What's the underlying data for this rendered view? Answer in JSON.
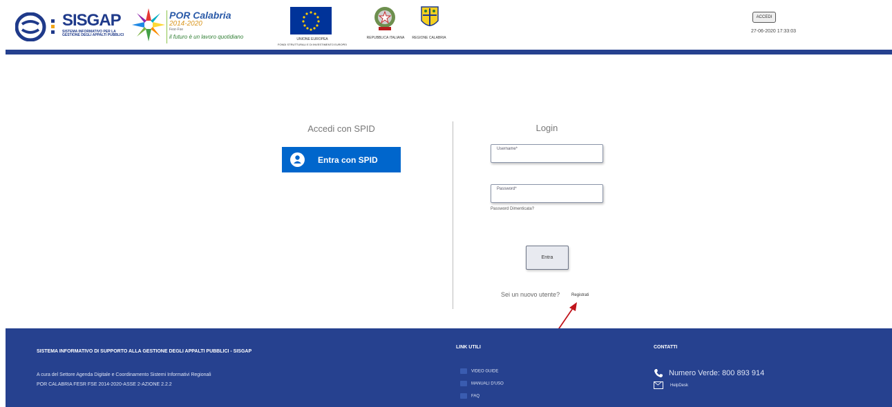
{
  "header": {
    "sisgap_brand": "SISGAP",
    "sisgap_sub": "SISTEMA INFORMATIVO PER LA GESTIONE DEGLI APPALTI PUBBLICI",
    "por_title": "POR Calabria",
    "por_years": "2014-2020",
    "por_fesr": "Fesr-Fse",
    "por_motto": "il futuro è un lavoro quotidiano",
    "eu_caption1": "UNIONE EUROPEA",
    "eu_caption2": "FONDI STRUTTURALI E DI INVESTIMENTO EUROPEI",
    "rep_caption": "REPUBBLICA ITALIANA",
    "cal_caption": "REGIONE CALABRIA",
    "accedi_label": "ACCEDI",
    "datetime": "27-06-2020 17:33:03"
  },
  "spid": {
    "title": "Accedi con SPID",
    "button_label": "Entra con SPID"
  },
  "login": {
    "title": "Login",
    "username_placeholder": "Username*",
    "password_placeholder": "Password*",
    "forgot_label": "Password Dimenticata?",
    "submit_label": "Entra",
    "new_user_text": "Sei un nuovo utente?",
    "register_label": "Registrati"
  },
  "footer": {
    "title": "SISTEMA INFORMATIVO DI SUPPORTO ALLA GESTIONE DEGLI APPALTI PUBBLICI - SISGAP",
    "line1": "A cura del Settore Agenda Digitale e Coordinamento Sistemi Informativi Regionali",
    "line2": "POR CALABRIA FESR FSE 2014-2020-ASSE 2-AZIONE 2.2.2",
    "links_title": "LINK UTILI",
    "links": [
      "VIDEO GUIDE",
      "MANUALI D'USO",
      "FAQ"
    ],
    "contacts_title": "CONTATTI",
    "phone": "Numero Verde: 800 893 914",
    "helpdesk": "HelpDesk"
  },
  "colors": {
    "primary_blue": "#26418f",
    "spid_blue": "#0066cc",
    "annotation_arrow": "#c0141c"
  }
}
